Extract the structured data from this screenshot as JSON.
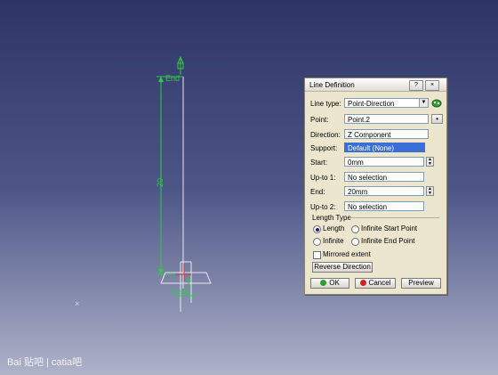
{
  "viewport": {
    "end_label": "End",
    "dimension_value": "20",
    "axis_x": "X",
    "axis_y": "Y",
    "axis_z": "Z",
    "start_label": "Start",
    "compass_mark": "×"
  },
  "dialog": {
    "title": "Line Definition",
    "help_button": "?",
    "close_button": "×",
    "line_type_label": "Line type:",
    "line_type_value": "Point-Direction",
    "point_label": "Point:",
    "point_value": "Point.2",
    "direction_label": "Direction:",
    "direction_value": "Z Component",
    "support_label": "Support:",
    "support_value": "Default (None)",
    "start_label": "Start:",
    "start_value": "0mm",
    "up_to_1_label": "Up-to 1:",
    "up_to_1_value": "No selection",
    "end_label": "End:",
    "end_value": "20mm",
    "up_to_2_label": "Up-to 2:",
    "up_to_2_value": "No selection",
    "length_type_label": "Length Type",
    "length_type_options": [
      "Length",
      "Infinite Start Point",
      "Infinite",
      "Infinite End Point"
    ],
    "length_type_selected": "Length",
    "mirrored_extent_label": "Mirrored extent",
    "mirrored_extent_checked": false,
    "reverse_direction_button": "Reverse Direction",
    "ok_button": "OK",
    "cancel_button": "Cancel",
    "preview_button": "Preview"
  },
  "watermark": {
    "text": "Baié¸ è´´å§ | catiaå§",
    "display": "Bai 贴吧 | catia吧"
  },
  "colors": {
    "background_top": "#2e3566",
    "background_bottom": "#aeb3c8",
    "dimension_green": "#2ecc40",
    "selection_blue": "#3a6fd6",
    "dialog_bg": "#ece6cf",
    "ok_icon": "#2e9e2e",
    "cancel_icon": "#d02020"
  }
}
